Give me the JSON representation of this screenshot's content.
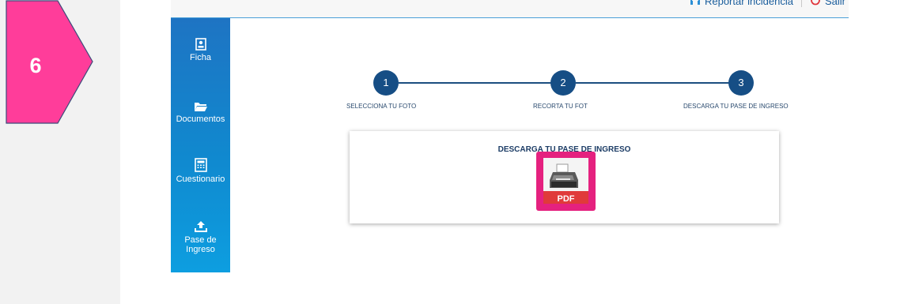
{
  "step_badge": {
    "number": "6",
    "color": "#ff3d9a"
  },
  "topbar": {
    "report_label": "Reportar incidencia",
    "logout_label": "Salir"
  },
  "sidebar": {
    "items": [
      {
        "label": "Ficha",
        "icon": "id-card-icon"
      },
      {
        "label": "Documentos",
        "icon": "folder-icon"
      },
      {
        "label": "Cuestionario",
        "icon": "calculator-icon"
      },
      {
        "label": "Pase de Ingreso",
        "icon": "upload-icon"
      }
    ]
  },
  "stepper": {
    "steps": [
      {
        "number": "1",
        "label": "SELECCIONA TU FOTO"
      },
      {
        "number": "2",
        "label": "RECORTA TU FOT"
      },
      {
        "number": "3",
        "label": "DESCARGA TU PASE DE INGRESO"
      }
    ]
  },
  "card": {
    "title": "DESCARGA TU PASE DE INGRESO",
    "pdf_label": "PDF",
    "icon": "printer-pdf-icon"
  },
  "colors": {
    "accent_blue": "#164e85",
    "sidebar_blue": "#1e74c3",
    "highlight_pink": "#e5217f"
  }
}
